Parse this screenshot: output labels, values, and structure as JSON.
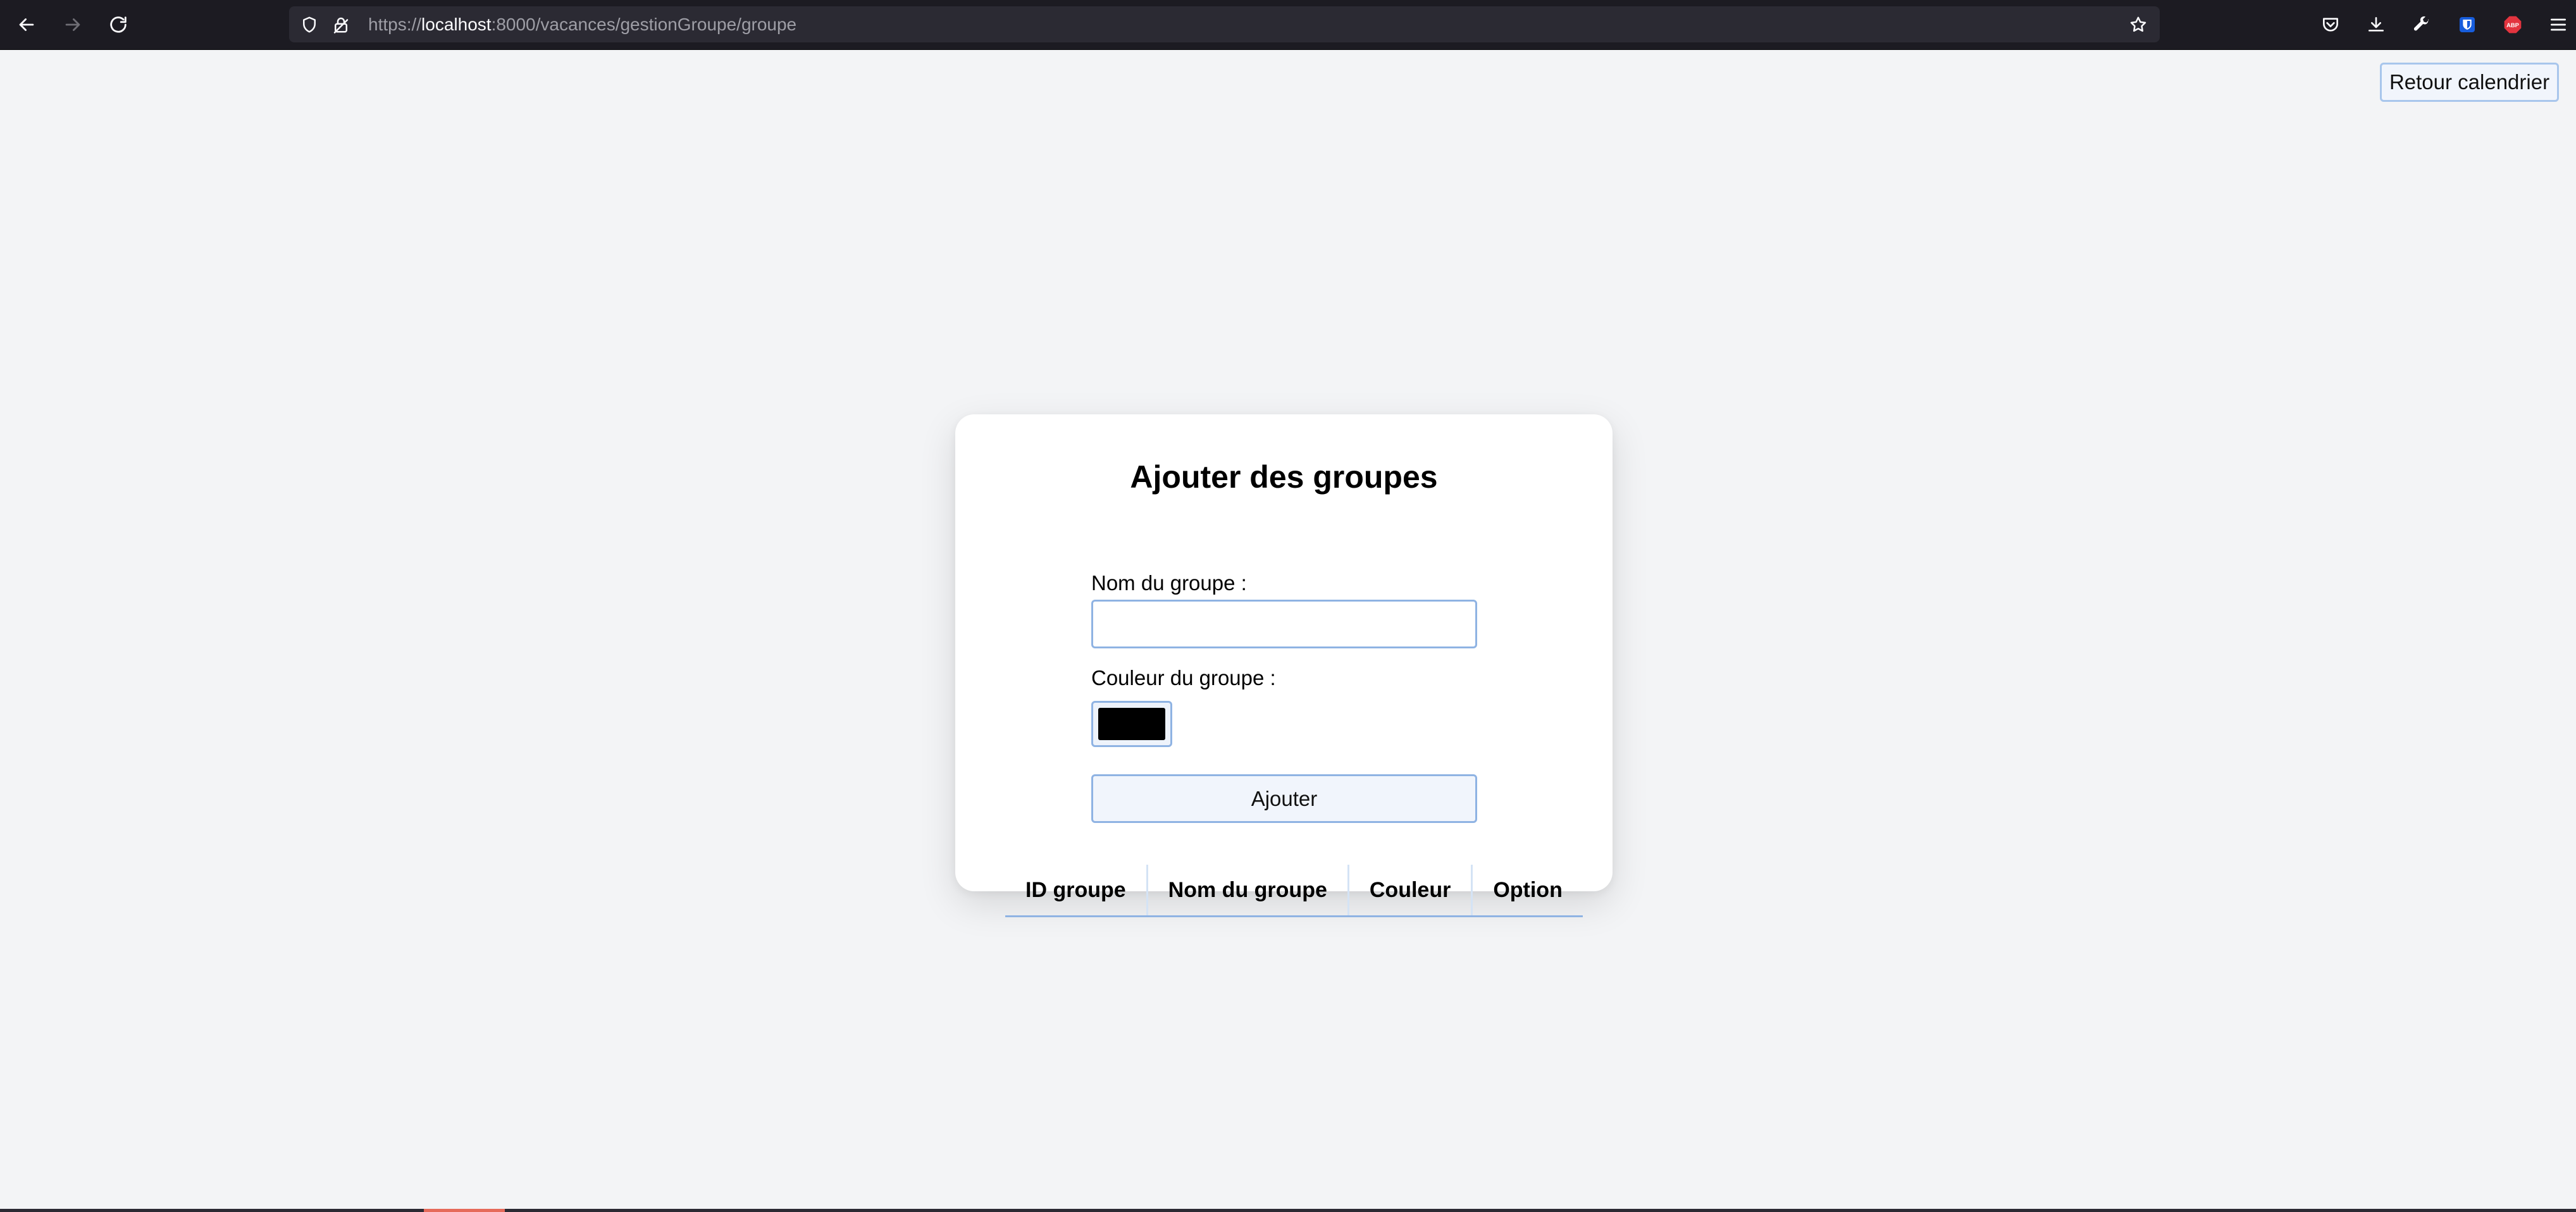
{
  "browser": {
    "url_prefix": "https://",
    "url_host": "localhost",
    "url_path": ":8000/vacances/gestionGroupe/groupe",
    "toolbar_icons": [
      "back-arrow-icon",
      "forward-arrow-icon",
      "reload-icon",
      "shield-icon",
      "lock-icon",
      "bookmark-star-icon",
      "pocket-icon",
      "download-icon",
      "wrench-icon",
      "bitwarden-icon",
      "adblock-icon",
      "menu-icon"
    ],
    "adblock_label": "ABP"
  },
  "header": {
    "back_button_label": "Retour calendrier"
  },
  "form": {
    "title": "Ajouter des groupes",
    "name_label": "Nom du groupe :",
    "name_value": "",
    "color_label": "Couleur du groupe :",
    "color_value": "#000000",
    "submit_label": "Ajouter"
  },
  "table": {
    "columns": [
      "ID groupe",
      "Nom du groupe",
      "Couleur",
      "Option"
    ],
    "rows": []
  },
  "colors": {
    "page_background": "#f3f4f6",
    "card_background": "#ffffff",
    "accent_border": "#8fb3e3",
    "browser_chrome": "#1c1b22"
  }
}
